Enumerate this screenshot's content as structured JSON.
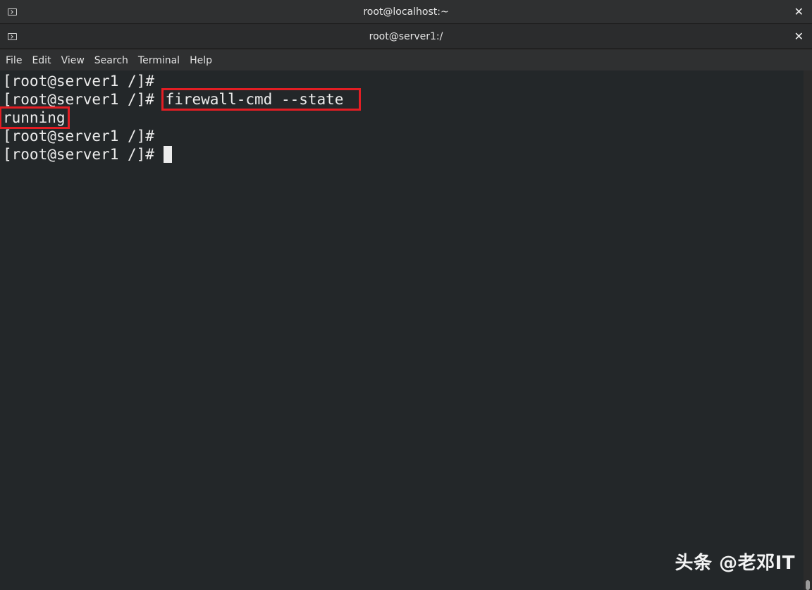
{
  "windows": {
    "outer_title": "root@localhost:~",
    "inner_title": "root@server1:/",
    "close_glyph": "✕"
  },
  "menu": {
    "items": [
      "File",
      "Edit",
      "View",
      "Search",
      "Terminal",
      "Help"
    ]
  },
  "terminal": {
    "prompt": "[root@server1 /]# ",
    "command": "firewall-cmd --state",
    "output": "running",
    "highlight_color": "#e31e24",
    "background_color": "#232729",
    "text_color": "#ececec"
  },
  "watermark": {
    "text": "头条 @老邓IT"
  },
  "icons": {
    "window": "terminal-icon",
    "close": "close-icon"
  }
}
